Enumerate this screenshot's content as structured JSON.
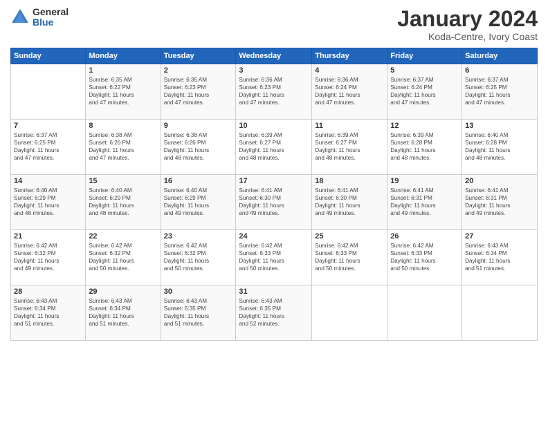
{
  "logo": {
    "general": "General",
    "blue": "Blue"
  },
  "title": "January 2024",
  "location": "Koda-Centre, Ivory Coast",
  "days_header": [
    "Sunday",
    "Monday",
    "Tuesday",
    "Wednesday",
    "Thursday",
    "Friday",
    "Saturday"
  ],
  "weeks": [
    [
      {
        "day": "",
        "info": ""
      },
      {
        "day": "1",
        "info": "Sunrise: 6:35 AM\nSunset: 6:22 PM\nDaylight: 11 hours\nand 47 minutes."
      },
      {
        "day": "2",
        "info": "Sunrise: 6:35 AM\nSunset: 6:23 PM\nDaylight: 11 hours\nand 47 minutes."
      },
      {
        "day": "3",
        "info": "Sunrise: 6:36 AM\nSunset: 6:23 PM\nDaylight: 11 hours\nand 47 minutes."
      },
      {
        "day": "4",
        "info": "Sunrise: 6:36 AM\nSunset: 6:24 PM\nDaylight: 11 hours\nand 47 minutes."
      },
      {
        "day": "5",
        "info": "Sunrise: 6:37 AM\nSunset: 6:24 PM\nDaylight: 11 hours\nand 47 minutes."
      },
      {
        "day": "6",
        "info": "Sunrise: 6:37 AM\nSunset: 6:25 PM\nDaylight: 11 hours\nand 47 minutes."
      }
    ],
    [
      {
        "day": "7",
        "info": "Sunrise: 6:37 AM\nSunset: 6:25 PM\nDaylight: 11 hours\nand 47 minutes."
      },
      {
        "day": "8",
        "info": "Sunrise: 6:38 AM\nSunset: 6:26 PM\nDaylight: 11 hours\nand 47 minutes."
      },
      {
        "day": "9",
        "info": "Sunrise: 6:38 AM\nSunset: 6:26 PM\nDaylight: 11 hours\nand 48 minutes."
      },
      {
        "day": "10",
        "info": "Sunrise: 6:39 AM\nSunset: 6:27 PM\nDaylight: 11 hours\nand 48 minutes."
      },
      {
        "day": "11",
        "info": "Sunrise: 6:39 AM\nSunset: 6:27 PM\nDaylight: 11 hours\nand 48 minutes."
      },
      {
        "day": "12",
        "info": "Sunrise: 6:39 AM\nSunset: 6:28 PM\nDaylight: 11 hours\nand 48 minutes."
      },
      {
        "day": "13",
        "info": "Sunrise: 6:40 AM\nSunset: 6:28 PM\nDaylight: 11 hours\nand 48 minutes."
      }
    ],
    [
      {
        "day": "14",
        "info": "Sunrise: 6:40 AM\nSunset: 6:29 PM\nDaylight: 11 hours\nand 48 minutes."
      },
      {
        "day": "15",
        "info": "Sunrise: 6:40 AM\nSunset: 6:29 PM\nDaylight: 11 hours\nand 48 minutes."
      },
      {
        "day": "16",
        "info": "Sunrise: 6:40 AM\nSunset: 6:29 PM\nDaylight: 11 hours\nand 49 minutes."
      },
      {
        "day": "17",
        "info": "Sunrise: 6:41 AM\nSunset: 6:30 PM\nDaylight: 11 hours\nand 49 minutes."
      },
      {
        "day": "18",
        "info": "Sunrise: 6:41 AM\nSunset: 6:30 PM\nDaylight: 11 hours\nand 49 minutes."
      },
      {
        "day": "19",
        "info": "Sunrise: 6:41 AM\nSunset: 6:31 PM\nDaylight: 11 hours\nand 49 minutes."
      },
      {
        "day": "20",
        "info": "Sunrise: 6:41 AM\nSunset: 6:31 PM\nDaylight: 11 hours\nand 49 minutes."
      }
    ],
    [
      {
        "day": "21",
        "info": "Sunrise: 6:42 AM\nSunset: 6:32 PM\nDaylight: 11 hours\nand 49 minutes."
      },
      {
        "day": "22",
        "info": "Sunrise: 6:42 AM\nSunset: 6:32 PM\nDaylight: 11 hours\nand 50 minutes."
      },
      {
        "day": "23",
        "info": "Sunrise: 6:42 AM\nSunset: 6:32 PM\nDaylight: 11 hours\nand 50 minutes."
      },
      {
        "day": "24",
        "info": "Sunrise: 6:42 AM\nSunset: 6:33 PM\nDaylight: 11 hours\nand 50 minutes."
      },
      {
        "day": "25",
        "info": "Sunrise: 6:42 AM\nSunset: 6:33 PM\nDaylight: 11 hours\nand 50 minutes."
      },
      {
        "day": "26",
        "info": "Sunrise: 6:42 AM\nSunset: 6:33 PM\nDaylight: 11 hours\nand 50 minutes."
      },
      {
        "day": "27",
        "info": "Sunrise: 6:43 AM\nSunset: 6:34 PM\nDaylight: 11 hours\nand 51 minutes."
      }
    ],
    [
      {
        "day": "28",
        "info": "Sunrise: 6:43 AM\nSunset: 6:34 PM\nDaylight: 11 hours\nand 51 minutes."
      },
      {
        "day": "29",
        "info": "Sunrise: 6:43 AM\nSunset: 6:34 PM\nDaylight: 11 hours\nand 51 minutes."
      },
      {
        "day": "30",
        "info": "Sunrise: 6:43 AM\nSunset: 6:35 PM\nDaylight: 11 hours\nand 51 minutes."
      },
      {
        "day": "31",
        "info": "Sunrise: 6:43 AM\nSunset: 6:35 PM\nDaylight: 11 hours\nand 52 minutes."
      },
      {
        "day": "",
        "info": ""
      },
      {
        "day": "",
        "info": ""
      },
      {
        "day": "",
        "info": ""
      }
    ]
  ]
}
